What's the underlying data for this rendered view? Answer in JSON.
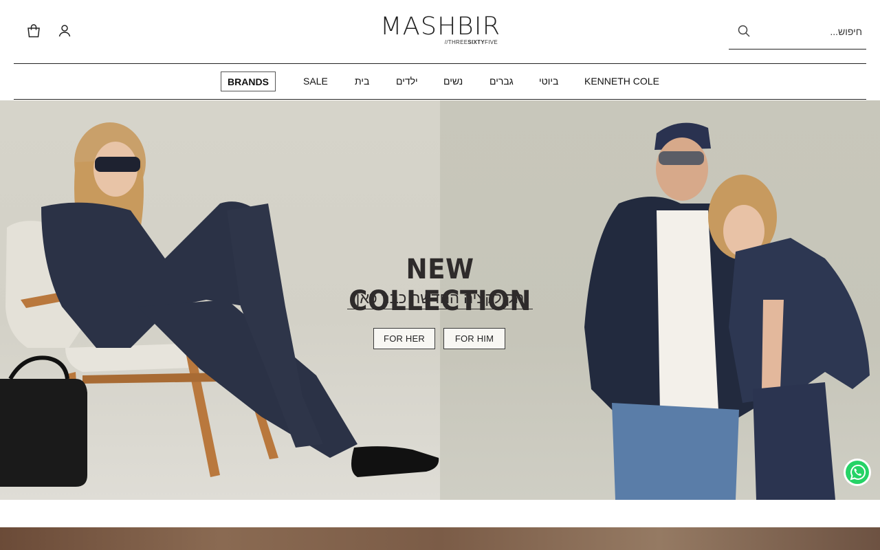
{
  "header": {
    "logo": {
      "main": "MASHBIR",
      "sub_prefix": "//THREE",
      "sub_bold": "SIXTY",
      "sub_suffix": "FIVE"
    },
    "search": {
      "placeholder": "חיפוש...",
      "value": "",
      "icon": "search-icon"
    },
    "icons": {
      "cart": "shopping-bag-icon",
      "account": "user-icon"
    }
  },
  "nav": {
    "items": [
      {
        "label": "KENNETH COLE"
      },
      {
        "label": "ביוטי"
      },
      {
        "label": "גברים"
      },
      {
        "label": "נשים"
      },
      {
        "label": "ילדים"
      },
      {
        "label": "בית"
      },
      {
        "label": "SALE"
      }
    ],
    "brands_label": "BRANDS"
  },
  "hero": {
    "title": "NEW COLLECTION",
    "subtitle": "הקולקציה החדשה כבר כאן",
    "buttons": {
      "her": "FOR HER",
      "him": "FOR HIM"
    }
  },
  "floating": {
    "whatsapp_icon": "whatsapp-icon"
  },
  "colors": {
    "accent_dark": "#2e2b2b",
    "whatsapp": "#25d366",
    "hero_left_bg": "#d6d4ca",
    "hero_right_bg": "#c8c7bb"
  }
}
